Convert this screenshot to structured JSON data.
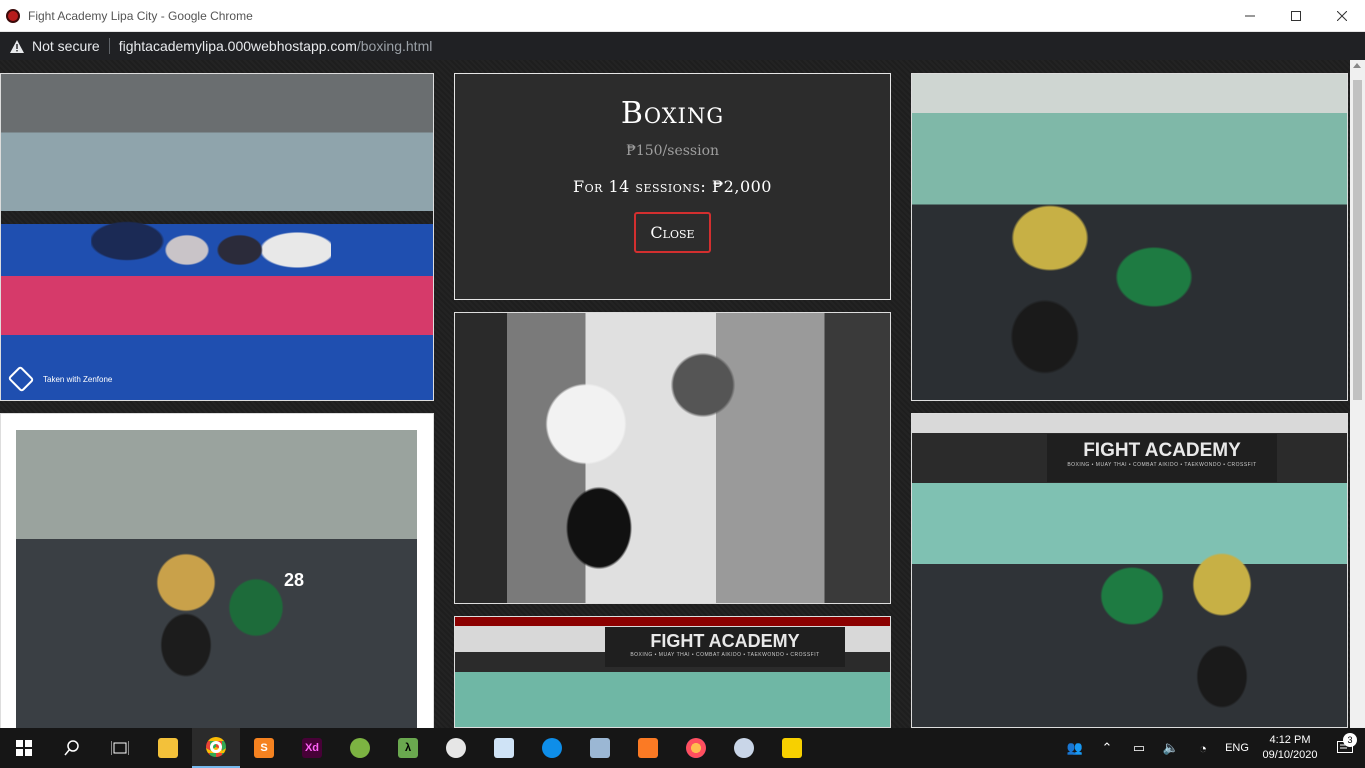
{
  "window": {
    "title": "Fight Academy Lipa City - Google Chrome"
  },
  "addressbar": {
    "security_label": "Not secure",
    "url_host": "fightacademylipa.000webhostapp.com",
    "url_path": "/boxing.html"
  },
  "card": {
    "name": "Boxing",
    "price": "₱150/session",
    "package": "For 14 sessions: ₱2,000",
    "close_label": "Close"
  },
  "photos": {
    "watermark": "Taken with Zenfone",
    "banner_title": "FIGHT ACADEMY",
    "banner_sub": "BOXING • MUAY THAI • COMBAT AIKIDO • TAEKWONDO • CROSSFIT",
    "jersey_number": "28"
  },
  "taskbar": {
    "apps": [
      "start-icon",
      "search-icon",
      "task-view-icon",
      "file-explorer-icon",
      "chrome-icon",
      "sublime-text-icon",
      "adobe-xd-icon",
      "chameleon-icon",
      "lambda-icon",
      "paint-icon",
      "dreamweaver-icon",
      "teamviewer-icon",
      "remote-desktop-icon",
      "xampp-icon",
      "firefox-icon",
      "settings-app-icon",
      "sticky-notes-icon"
    ],
    "xd_label": "Xd",
    "lambda_label": "λ",
    "language": "ENG",
    "time": "4:12 PM",
    "date": "09/10/2020",
    "notification_count": "3"
  }
}
